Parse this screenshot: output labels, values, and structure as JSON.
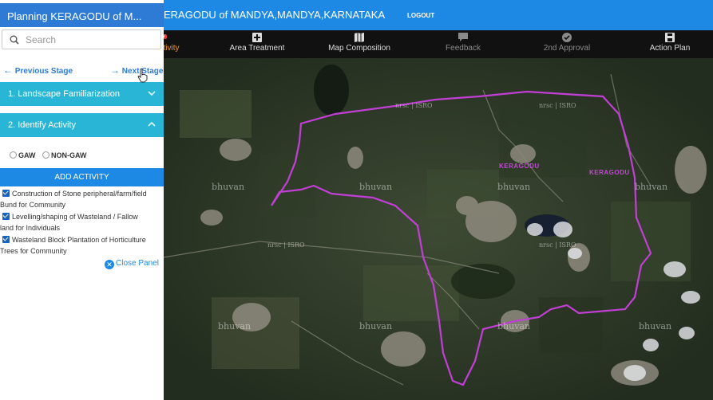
{
  "header": {
    "title": "ERAGODU of MANDYA,MANDYA,KARNATAKA",
    "logout": "LOGOUT"
  },
  "toolbar": {
    "items": [
      {
        "label": "ctivity",
        "badge": "ew",
        "state": "active",
        "icon": "activity-icon"
      },
      {
        "label": "Area Treatment",
        "state": "enabled",
        "icon": "plus-square-icon"
      },
      {
        "label": "Map Composition",
        "state": "enabled",
        "icon": "map-icon"
      },
      {
        "label": "Feedback",
        "state": "disabled",
        "icon": "comment-icon"
      },
      {
        "label": "2nd Approval",
        "state": "disabled",
        "icon": "check-circle-icon"
      },
      {
        "label": "Action Plan",
        "state": "enabled",
        "icon": "floppy-icon"
      }
    ]
  },
  "panel": {
    "title": "Planning KERAGODU of M...",
    "search_placeholder": "Search",
    "prev_label": "Previous Stage",
    "next_label": "Next Stage",
    "sections": [
      {
        "label": "1. Landscape Familiarization",
        "expanded": false
      },
      {
        "label": "2. Identify Activity",
        "expanded": true
      }
    ],
    "radios": [
      "GAW",
      "NON-GAW"
    ],
    "add_button": "ADD ACTIVITY",
    "activities": [
      {
        "line1": "Construction of Stone peripheral/farm/field",
        "line2": "Bund for Community"
      },
      {
        "line1": "Levelling/shaping of Wasteland / Fallow",
        "line2": "land for Individuals"
      },
      {
        "line1": "Wasteland Block Plantation of Horticulture",
        "line2": "Trees for Community"
      }
    ],
    "close_label": "Close Panel"
  },
  "map": {
    "watermark": "bhuvan",
    "isro_mark": "nrsc | ISRO",
    "village_labels": [
      "KERAGODU",
      "KERAGODU"
    ],
    "boundary_color": "#c23fd6"
  }
}
